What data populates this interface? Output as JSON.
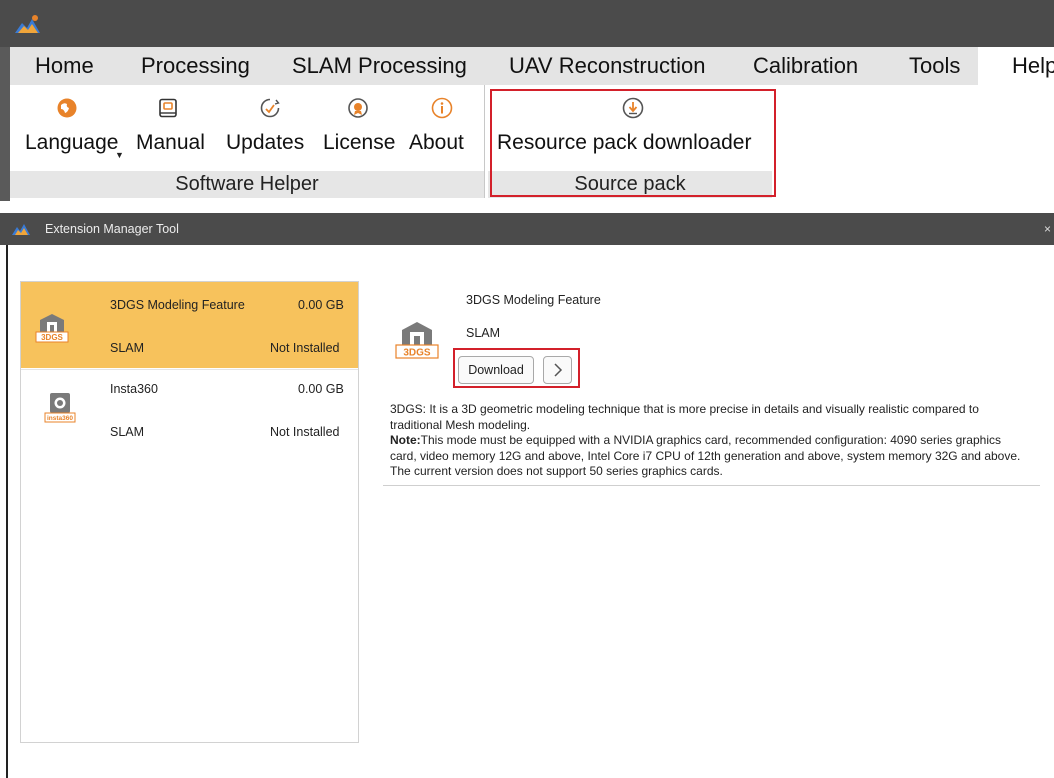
{
  "app": {
    "menu": [
      "Home",
      "Processing",
      "SLAM Processing",
      "UAV Reconstruction",
      "Calibration",
      "Tools",
      "Help"
    ],
    "ribbon": {
      "buttons": [
        {
          "label": "Language",
          "icon": "globe-icon"
        },
        {
          "label": "Manual",
          "icon": "manual-icon"
        },
        {
          "label": "Updates",
          "icon": "updates-icon"
        },
        {
          "label": "License",
          "icon": "license-icon"
        },
        {
          "label": "About",
          "icon": "info-icon"
        },
        {
          "label": "Resource pack downloader",
          "icon": "download-icon"
        }
      ],
      "groups": [
        "Software Helper",
        "Source pack"
      ]
    }
  },
  "dialog": {
    "title": "Extension Manager Tool",
    "close": "×",
    "extensions": [
      {
        "name": "3DGS Modeling Feature",
        "size": "0.00 GB",
        "category": "SLAM",
        "status": "Not Installed",
        "icon": "3dgs-icon",
        "icon_badge": "3DGS"
      },
      {
        "name": "Insta360",
        "size": "0.00 GB",
        "category": "SLAM",
        "status": "Not Installed",
        "icon": "insta360-icon",
        "icon_badge": "insta360"
      }
    ],
    "detail": {
      "name": "3DGS Modeling Feature",
      "category": "SLAM",
      "icon_badge": "3DGS",
      "download_label": "Download",
      "desc_line1": "3DGS: It is a 3D geometric modeling technique that is more precise in details and visually realistic compared to",
      "desc_line2": "traditional Mesh modeling.",
      "note_label": "Note:",
      "note_line1": "This mode must be equipped with a NVIDIA graphics card, recommended configuration: 4090 series graphics",
      "note_line2": "card, video memory 12G and above, Intel Core i7 CPU of 12th generation and above, system memory 32G and above.",
      "note_line3": "The current version does not support 50 series graphics cards."
    }
  },
  "colors": {
    "titlebar": "#4b4b4b",
    "menubar": "#e4e4e4",
    "selected_row": "#f7c25c",
    "highlight_box": "#d3202a",
    "icon_orange": "#e8832a"
  }
}
